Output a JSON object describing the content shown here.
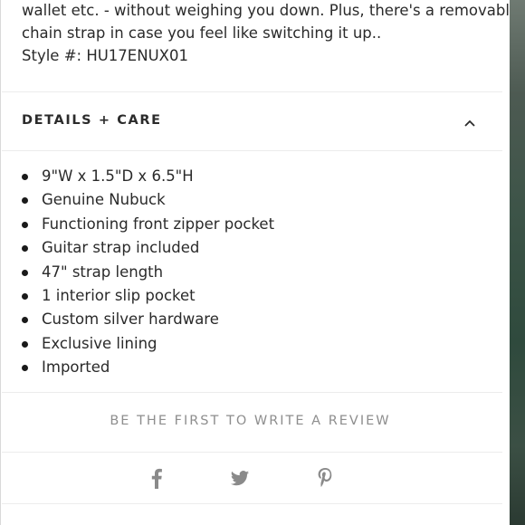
{
  "description": {
    "line1": "wallet etc. - without weighing you down. Plus, there's a removable",
    "line2": "chain strap in case you feel like switching it up..",
    "style_line": "Style #: HU17ENUX01"
  },
  "details_care": {
    "title": "DETAILS + CARE",
    "expanded": true,
    "items": [
      "9\"W x 1.5\"D x 6.5\"H",
      "Genuine Nubuck",
      "Functioning front zipper pocket",
      "Guitar strap included",
      "47\" strap length",
      "1 interior slip pocket",
      "Custom silver hardware",
      "Exclusive lining",
      "Imported"
    ]
  },
  "review": {
    "label": "BE THE FIRST TO WRITE A REVIEW"
  },
  "share": {
    "icons": [
      "facebook-icon",
      "twitter-icon",
      "pinterest-icon"
    ],
    "color": "#8a8a8a"
  },
  "colors": {
    "text": "#2a2a2a",
    "muted": "#8e8e8e",
    "divider": "#ececec"
  }
}
